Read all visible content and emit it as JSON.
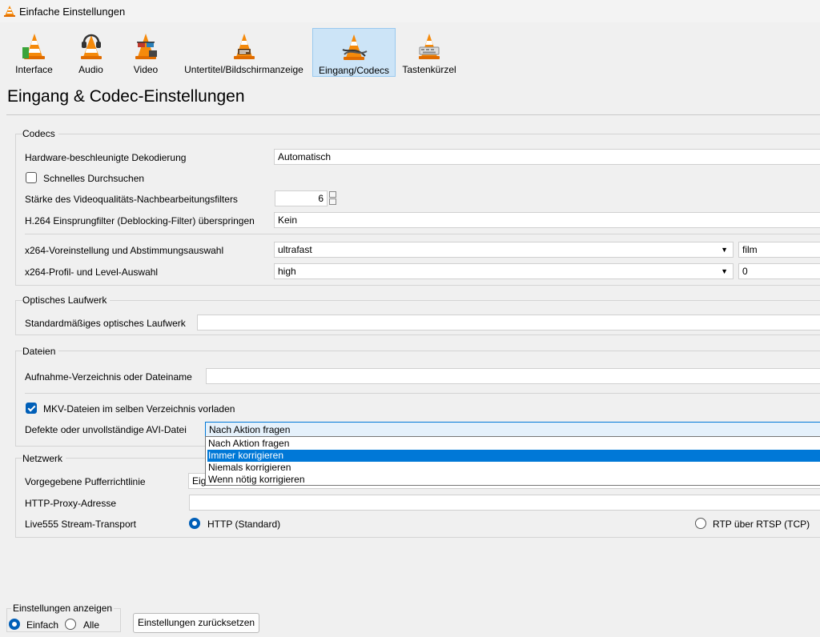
{
  "window": {
    "title": "Einfache Einstellungen"
  },
  "toolbar": {
    "tabs": [
      {
        "label": "Interface",
        "icon": "cone-interface-icon"
      },
      {
        "label": "Audio",
        "icon": "cone-headphones-icon"
      },
      {
        "label": "Video",
        "icon": "cone-glasses-icon"
      },
      {
        "label": "Untertitel/Bildschirmanzeige",
        "icon": "cone-subtitles-icon"
      },
      {
        "label": "Eingang/Codecs",
        "icon": "cone-cables-icon"
      },
      {
        "label": "Tastenkürzel",
        "icon": "cone-hotkeys-icon"
      }
    ],
    "active_tab": "Eingang/Codecs"
  },
  "page_title": "Eingang & Codec-Einstellungen",
  "codecs": {
    "title": "Codecs",
    "hw_decoding": {
      "label": "Hardware-beschleunigte Dekodierung",
      "value": "Automatisch"
    },
    "fast_seek": {
      "label": "Schnelles Durchsuchen",
      "checked": false
    },
    "pp_quality": {
      "label": "Stärke des Videoqualitäts-Nachbearbeitungsfilters",
      "value": "6"
    },
    "skip_loop": {
      "label": "H.264 Einsprungfilter (Deblocking-Filter) überspringen",
      "value": "Kein"
    },
    "x264_preset": {
      "label": "x264-Voreinstellung und Abstimmungsauswahl",
      "preset": "ultrafast",
      "tune": "film"
    },
    "x264_profile": {
      "label": "x264-Profil- und Level-Auswahl",
      "profile": "high",
      "level": "0"
    }
  },
  "optical": {
    "title": "Optisches Laufwerk",
    "drive": {
      "label": "Standardmäßiges optisches Laufwerk",
      "value": ""
    }
  },
  "files": {
    "title": "Dateien",
    "record": {
      "label": "Aufnahme-Verzeichnis oder Dateiname",
      "value": ""
    },
    "mkv_preload": {
      "label": "MKV-Dateien im selben Verzeichnis vorladen",
      "checked": true
    },
    "avi": {
      "label": "Defekte oder unvollständige AVI-Datei",
      "value": "Nach Aktion fragen",
      "options": [
        "Nach Aktion fragen",
        "Immer korrigieren",
        "Niemals korrigieren",
        "Wenn nötig korrigieren"
      ],
      "highlighted": "Immer korrigieren"
    }
  },
  "network": {
    "title": "Netzwerk",
    "caching": {
      "label": "Vorgegebene Pufferrichtlinie",
      "value": "Eig"
    },
    "proxy": {
      "label": "HTTP-Proxy-Adresse",
      "value": ""
    },
    "transport": {
      "label": "Live555 Stream-Transport",
      "http": "HTTP (Standard)",
      "rtsp": "RTP über RTSP (TCP)",
      "selected": "HTTP (Standard)"
    }
  },
  "footer": {
    "show_settings": "Einstellungen anzeigen",
    "simple": "Einfach",
    "all": "Alle",
    "selected": "Einfach",
    "reset": "Einstellungen zurücksetzen"
  },
  "colors": {
    "accent": "#005fb8",
    "selection": "#0078d7",
    "cone_orange": "#f58a0b",
    "active_tab": "#cce4f7"
  }
}
